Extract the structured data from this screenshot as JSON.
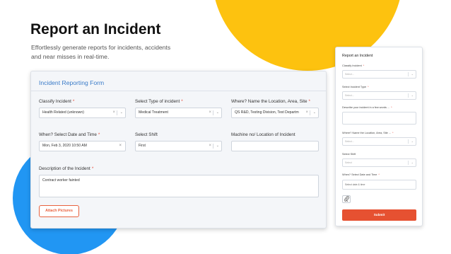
{
  "hero": {
    "title": "Report an Incident",
    "subtitle": "Effortlessly generate reports for incidents, accidents and near misses in real-time."
  },
  "main_form": {
    "title": "Incident Reporting Form",
    "fields": {
      "classify": {
        "label": "Classify Incident",
        "required": "*",
        "value": "Health Related (unknown)"
      },
      "type": {
        "label": "Select Type of incident",
        "required": "*",
        "value": "Medical Treatment"
      },
      "location": {
        "label": "Where? Name the Location, Area, Site",
        "required": "*",
        "value": "QS R&D, Testing Division, Test Departm"
      },
      "datetime": {
        "label": "When? Select Date and Time",
        "required": "*",
        "value": "Mon, Feb 3, 2020 10:50 AM"
      },
      "shift": {
        "label": "Select Shift",
        "value": "First"
      },
      "machine": {
        "label": "Machine no/ Location of Incident",
        "value": ""
      },
      "description": {
        "label": "Description of the Incident",
        "required": "*",
        "value": "Contract worker fainted"
      }
    },
    "attach_label": "Attach Pictures"
  },
  "mobile_form": {
    "title": "Report an Incident",
    "classify_label": "Classify Incident",
    "classify_placeholder": "Select...",
    "type_label": "Select Incident Type",
    "type_placeholder": "Select...",
    "describe_label": "Describe your incident in a few words ...",
    "location_label": "Where? Name the Location, Area, Site ...",
    "location_placeholder": "Select...",
    "shift_label": "Select Shift",
    "shift_placeholder": "Select",
    "datetime_label": "When? Select Date and Time",
    "datetime_placeholder": "Select date & time",
    "required_mark": "*",
    "submit_label": "Submit"
  },
  "icons": {
    "clear": "×",
    "chevron": "⌄",
    "calendar_clear": "×",
    "attach": "🔗"
  },
  "colors": {
    "accent_blue": "#3a7bc8",
    "submit_orange": "#e65131",
    "required_red": "#e74c3c",
    "deco_yellow": "#fdc20f",
    "deco_blue": "#2196f3"
  }
}
